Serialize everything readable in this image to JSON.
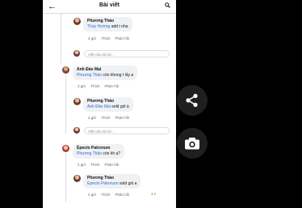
{
  "header": {
    "title": "Bài viết"
  },
  "comments": [
    {
      "name": "Phương Thảo",
      "mention": "Thúy Hường",
      "text": " add t nha",
      "time": "3 giờ",
      "like": "Thích",
      "reply": "Phản hồi"
    },
    {
      "name": "Anh Đào Mai",
      "mention": "Phương Thảo",
      "text": " còn khong t lấy a",
      "time": "3 giờ",
      "like": "Thích",
      "reply": "Phản hồi"
    },
    {
      "name": "Phương Thảo",
      "mention": "Anh Đào Mai",
      "text": " sold gói à",
      "time": "2 giờ",
      "like": "Thích",
      "reply": "Phản hồi"
    },
    {
      "name": "Épecto Patronum",
      "mention": "Phương Thảo",
      "text": " còn kh ạ?",
      "time": "2 giờ",
      "like": "Thích",
      "reply": "Phản hồi"
    },
    {
      "name": "Phương Thảo",
      "mention": "Épecto Patronum",
      "text": " sold gói a",
      "time": "2 giờ",
      "like": "Thích",
      "reply": "Phản hồi",
      "reactions": "1"
    }
  ],
  "reply_placeholder": "Viết câu trả lời...",
  "icons": {
    "back": "arrow-left-icon",
    "search": "search-icon",
    "share": "share-icon",
    "camera": "camera-icon"
  }
}
